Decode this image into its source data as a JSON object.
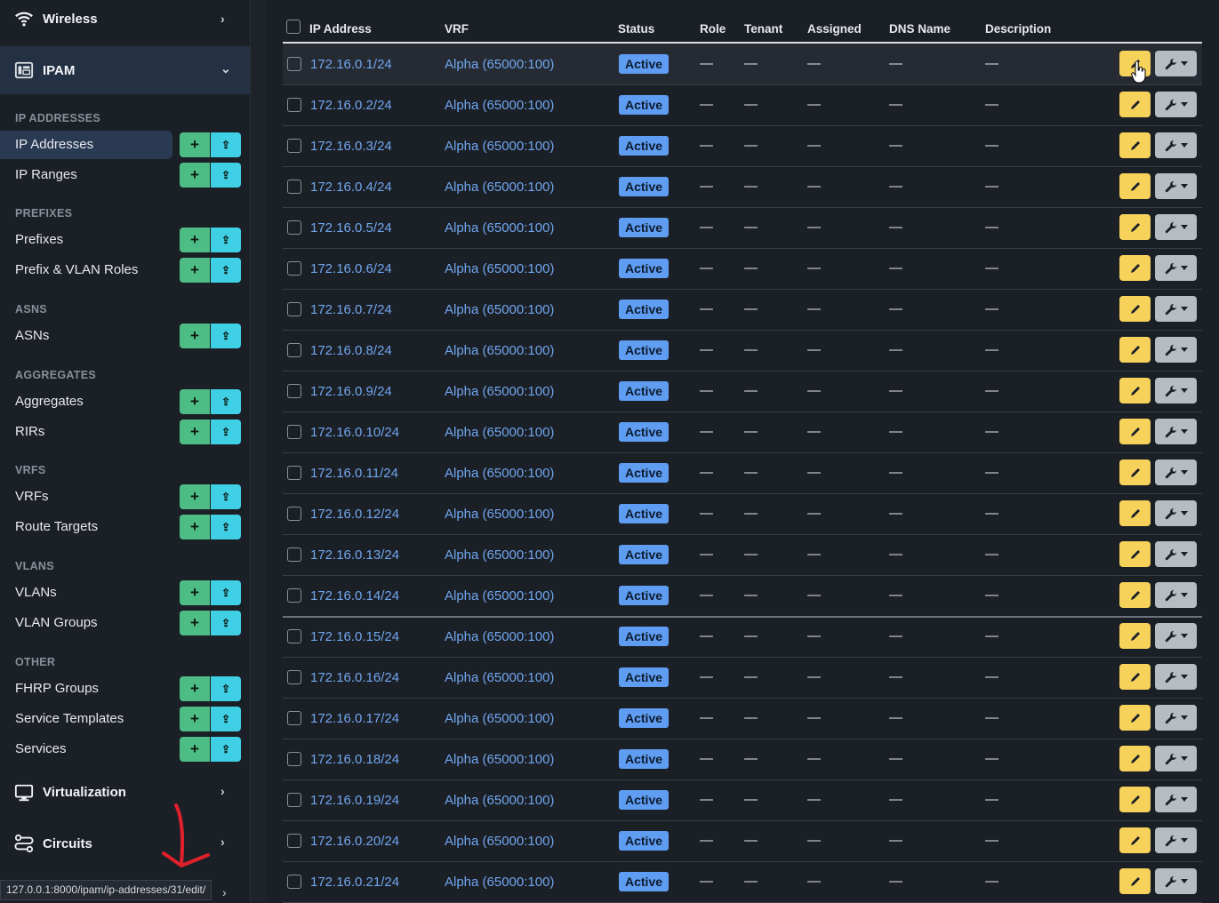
{
  "sidebar": {
    "wireless": {
      "label": "Wireless"
    },
    "ipam": {
      "label": "IPAM"
    },
    "virtualization": {
      "label": "Virtualization"
    },
    "circuits": {
      "label": "Circuits"
    },
    "sections": [
      {
        "label": "IP ADDRESSES",
        "items": [
          {
            "label": "IP Addresses",
            "active": true,
            "actions": true
          },
          {
            "label": "IP Ranges",
            "actions": true
          }
        ]
      },
      {
        "label": "PREFIXES",
        "items": [
          {
            "label": "Prefixes",
            "actions": true
          },
          {
            "label": "Prefix & VLAN Roles",
            "actions": true
          }
        ]
      },
      {
        "label": "ASNS",
        "items": [
          {
            "label": "ASNs",
            "actions": true
          }
        ]
      },
      {
        "label": "AGGREGATES",
        "items": [
          {
            "label": "Aggregates",
            "actions": true
          },
          {
            "label": "RIRs",
            "actions": true
          }
        ]
      },
      {
        "label": "VRFS",
        "items": [
          {
            "label": "VRFs",
            "actions": true
          },
          {
            "label": "Route Targets",
            "actions": true
          }
        ]
      },
      {
        "label": "VLANS",
        "items": [
          {
            "label": "VLANs",
            "actions": true
          },
          {
            "label": "VLAN Groups",
            "actions": true
          }
        ]
      },
      {
        "label": "OTHER",
        "items": [
          {
            "label": "FHRP Groups",
            "actions": true
          },
          {
            "label": "Service Templates",
            "actions": true
          },
          {
            "label": "Services",
            "actions": true
          }
        ]
      }
    ],
    "add_glyph": "+",
    "import_glyph": "⇪"
  },
  "status_bar": {
    "url": "127.0.0.1:8000/ipam/ip-addresses/31/edit/"
  },
  "table": {
    "columns": [
      "IP Address",
      "VRF",
      "Status",
      "Role",
      "Tenant",
      "Assigned",
      "DNS Name",
      "Description"
    ],
    "empty": "—",
    "rows": [
      {
        "ip": "172.16.0.1/24",
        "vrf": "Alpha (65000:100)",
        "status": "Active"
      },
      {
        "ip": "172.16.0.2/24",
        "vrf": "Alpha (65000:100)",
        "status": "Active"
      },
      {
        "ip": "172.16.0.3/24",
        "vrf": "Alpha (65000:100)",
        "status": "Active"
      },
      {
        "ip": "172.16.0.4/24",
        "vrf": "Alpha (65000:100)",
        "status": "Active"
      },
      {
        "ip": "172.16.0.5/24",
        "vrf": "Alpha (65000:100)",
        "status": "Active"
      },
      {
        "ip": "172.16.0.6/24",
        "vrf": "Alpha (65000:100)",
        "status": "Active"
      },
      {
        "ip": "172.16.0.7/24",
        "vrf": "Alpha (65000:100)",
        "status": "Active"
      },
      {
        "ip": "172.16.0.8/24",
        "vrf": "Alpha (65000:100)",
        "status": "Active"
      },
      {
        "ip": "172.16.0.9/24",
        "vrf": "Alpha (65000:100)",
        "status": "Active"
      },
      {
        "ip": "172.16.0.10/24",
        "vrf": "Alpha (65000:100)",
        "status": "Active"
      },
      {
        "ip": "172.16.0.11/24",
        "vrf": "Alpha (65000:100)",
        "status": "Active"
      },
      {
        "ip": "172.16.0.12/24",
        "vrf": "Alpha (65000:100)",
        "status": "Active"
      },
      {
        "ip": "172.16.0.13/24",
        "vrf": "Alpha (65000:100)",
        "status": "Active"
      },
      {
        "ip": "172.16.0.14/24",
        "vrf": "Alpha (65000:100)",
        "status": "Active"
      },
      {
        "ip": "172.16.0.15/24",
        "vrf": "Alpha (65000:100)",
        "status": "Active"
      },
      {
        "ip": "172.16.0.16/24",
        "vrf": "Alpha (65000:100)",
        "status": "Active"
      },
      {
        "ip": "172.16.0.17/24",
        "vrf": "Alpha (65000:100)",
        "status": "Active"
      },
      {
        "ip": "172.16.0.18/24",
        "vrf": "Alpha (65000:100)",
        "status": "Active"
      },
      {
        "ip": "172.16.0.19/24",
        "vrf": "Alpha (65000:100)",
        "status": "Active"
      },
      {
        "ip": "172.16.0.20/24",
        "vrf": "Alpha (65000:100)",
        "status": "Active"
      },
      {
        "ip": "172.16.0.21/24",
        "vrf": "Alpha (65000:100)",
        "status": "Active"
      }
    ]
  },
  "colors": {
    "link": "#70a7ef",
    "status_active": "#5f9df2",
    "edit_button": "#f7d25b",
    "tools_button": "#b7bcc3",
    "add_button": "#4dbd85",
    "import_button": "#3fd0e6",
    "annotation_arrow": "#e0202a"
  },
  "icons": {
    "wireless": "wifi-icon",
    "ipam": "ipam-icon",
    "virtualization": "monitor-icon",
    "circuits": "circuits-icon",
    "edit": "pencil-icon",
    "tools": "wrench-icon",
    "cursor": "hand-pointer-icon",
    "annotation": "red-arrow-annotation"
  }
}
